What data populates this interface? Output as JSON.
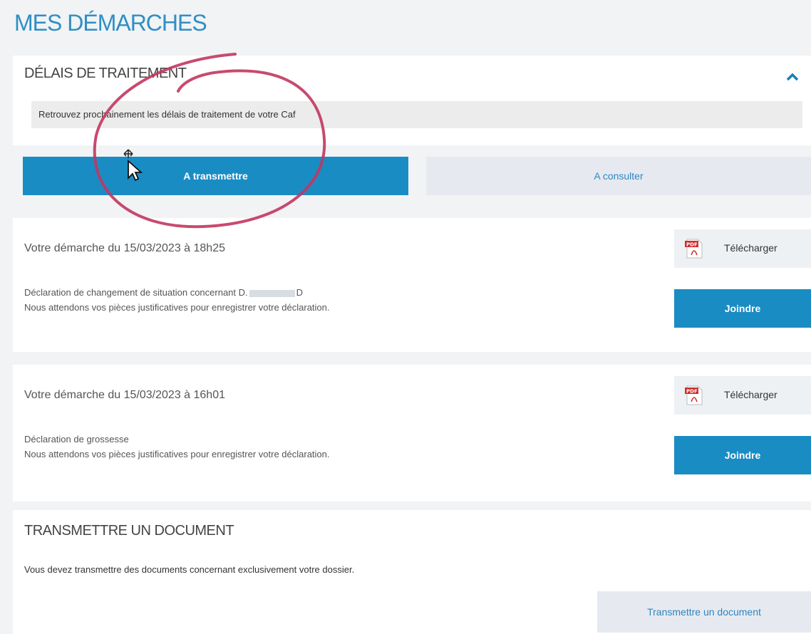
{
  "page_title": "MES DÉMARCHES",
  "delais": {
    "title": "DÉLAIS DE TRAITEMENT",
    "info": "Retrouvez prochainement les délais de traitement de votre Caf"
  },
  "tabs": {
    "active": "A transmettre",
    "inactive": "A consulter"
  },
  "demarches": [
    {
      "date": "Votre démarche du 15/03/2023 à 18h25",
      "line1_prefix": "Déclaration de changement de situation concernant D.",
      "line1_suffix": "D",
      "line2": "Nous attendons vos pièces justificatives pour enregistrer votre déclaration.",
      "download": "Télécharger",
      "join": "Joindre"
    },
    {
      "date": "Votre démarche du 15/03/2023 à 16h01",
      "line1": "Déclaration de grossesse",
      "line2": "Nous attendons vos pièces justificatives pour enregistrer votre déclaration.",
      "download": "Télécharger",
      "join": "Joindre"
    }
  ],
  "transmit": {
    "title": "TRANSMETTRE UN DOCUMENT",
    "desc": "Vous devez transmettre des documents concernant exclusivement votre dossier.",
    "button": "Transmettre un document"
  },
  "icons": {
    "collapse": "chevron-up-icon",
    "pdf": "pdf-icon",
    "cursor": "mouse-cursor-icon"
  },
  "colors": {
    "accent": "#1a8cc4",
    "title": "#2f8fc4",
    "annotation": "#c2365f"
  }
}
